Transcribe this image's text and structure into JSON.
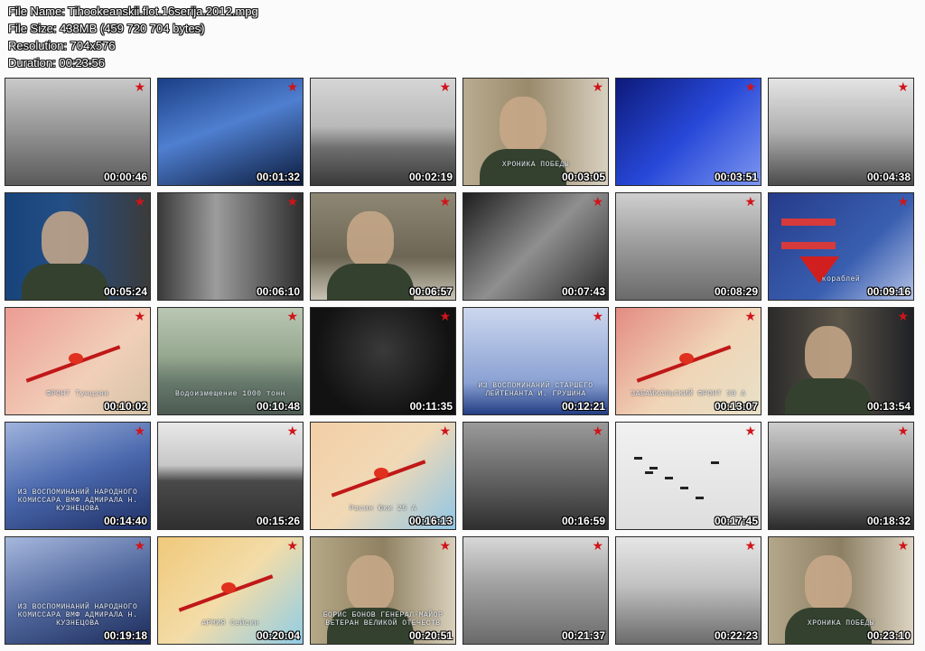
{
  "info": {
    "file_name": "File Name: Tihookeanskii.flot.16serija.2012.mpg",
    "file_size": "File Size: 438MB (459 720 704 bytes)",
    "resolution": "Resolution: 704x576",
    "duration": "Duration: 00:23:56"
  },
  "colors": {
    "star": "#d0141a",
    "background": "#fbfbfb"
  },
  "thumbnails": [
    {
      "time": "00:00:46",
      "scene": "gray-flags"
    },
    {
      "time": "00:01:32",
      "scene": "blue-sailors"
    },
    {
      "time": "00:02:19",
      "scene": "gray-coast"
    },
    {
      "time": "00:03:05",
      "scene": "veteran-chronicle",
      "text": "ХРОНИКА ПОБЕДЫ"
    },
    {
      "time": "00:03:51",
      "scene": "blue-uniform"
    },
    {
      "time": "00:04:38",
      "scene": "gray-gun"
    },
    {
      "time": "00:05:24",
      "scene": "admiral-portrait"
    },
    {
      "time": "00:06:10",
      "scene": "gray-sailors-parade"
    },
    {
      "time": "00:06:57",
      "scene": "officer-desk"
    },
    {
      "time": "00:07:43",
      "scene": "gray-tank"
    },
    {
      "time": "00:08:29",
      "scene": "gray-soldier-rifle"
    },
    {
      "time": "00:09:16",
      "scene": "ships-infographic",
      "text": "кораблей"
    },
    {
      "time": "00:10:02",
      "scene": "map-front",
      "text": "ФРОНТ Тунцзян"
    },
    {
      "time": "00:10:48",
      "scene": "ship-displacement",
      "text": "Водоизмещение 1000 тонн"
    },
    {
      "time": "00:11:35",
      "scene": "dark-night"
    },
    {
      "time": "00:12:21",
      "scene": "blue-document",
      "text": "ИЗ ВОСПОМИНАНИЙ СТАРШЕГО ЛЕЙТЕНАНТА И. ГРУШИНА"
    },
    {
      "time": "00:13:07",
      "scene": "map-zabaikalsky",
      "text": "ЗАБАЙКАЛЬСКИЙ ФРОНТ 39 А"
    },
    {
      "time": "00:13:54",
      "scene": "actor-officer"
    },
    {
      "time": "00:14:40",
      "scene": "blue-papers",
      "text": "ИЗ ВОСПОМИНАНИЙ НАРОДНОГО КОМИССАРА ВМФ АДМИРАЛА Н. КУЗНЕЦОВА"
    },
    {
      "time": "00:15:26",
      "scene": "gray-sea-ship"
    },
    {
      "time": "00:16:13",
      "scene": "map-rasin",
      "text": "Расин Юки 25 А"
    },
    {
      "time": "00:16:59",
      "scene": "gray-soldiers-group"
    },
    {
      "time": "00:17:45",
      "scene": "gray-planes"
    },
    {
      "time": "00:18:32",
      "scene": "gray-machinegun"
    },
    {
      "time": "00:19:18",
      "scene": "blue-papers-2",
      "text": "ИЗ ВОСПОМИНАНИЙ НАРОДНОГО КОМИССАРА ВМФ АДМИРАЛА Н. КУЗНЕЦОВА"
    },
    {
      "time": "00:20:04",
      "scene": "map-seishin",
      "text": "АРМИЯ Сейсин"
    },
    {
      "time": "00:20:51",
      "scene": "general-veteran",
      "text": "БОРИС БОНОВ ГЕНЕРАЛ-МАЙОР ВЕТЕРАН ВЕЛИКОЙ ОТЕЧЕСТВ"
    },
    {
      "time": "00:21:37",
      "scene": "gray-march"
    },
    {
      "time": "00:22:23",
      "scene": "gray-battlefield"
    },
    {
      "time": "00:23:10",
      "scene": "general-chronicle",
      "text": "ХРОНИКА ПОБЕДЫ"
    }
  ]
}
